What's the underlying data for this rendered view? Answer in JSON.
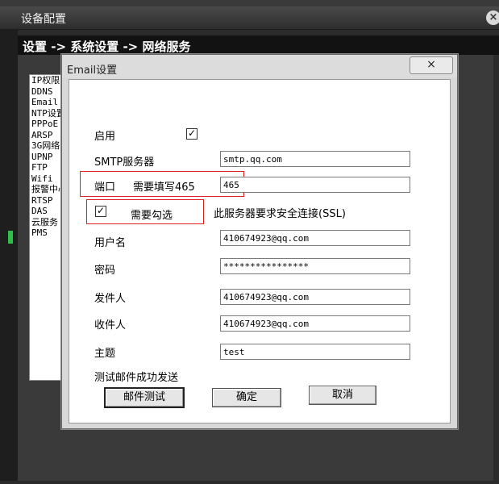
{
  "outer": {
    "title": "设备配置",
    "breadcrumb": "设置 -> 系统设置 -> 网络服务",
    "close_symbol": "×",
    "menu_items": [
      "IP权限",
      "DDNS",
      "Email",
      "NTP设置",
      "PPPoE",
      "ARSP",
      "3G网络",
      "UPNP",
      "FTP",
      "Wifi",
      "报警中心",
      "RTSP",
      "DAS",
      "云服务",
      "PMS"
    ]
  },
  "dialog": {
    "title": "Email设置",
    "close_symbol": "×",
    "enable_label": "启用",
    "enable_checked": true,
    "smtp_label": "SMTP服务器",
    "smtp_value": "smtp.qq.com",
    "port_label": "端口",
    "port_note": "需要填写465",
    "port_value": "465",
    "ssl_note": "需要勾选",
    "ssl_checked": true,
    "ssl_label": "此服务器要求安全连接(SSL)",
    "username_label": "用户名",
    "username_value": "410674923@qq.com",
    "password_label": "密码",
    "password_value": "****************",
    "sender_label": "发件人",
    "sender_value": "410674923@qq.com",
    "recipient_label": "收件人",
    "recipient_value": "410674923@qq.com",
    "subject_label": "主题",
    "subject_value": "test",
    "status_text": "测试邮件成功发送",
    "test_button": "邮件测试",
    "ok_button": "确定",
    "cancel_button": "取消",
    "check_symbol": "✓"
  },
  "colors": {
    "annotation_red": "#e02020",
    "status_green": "#2fbf4b"
  }
}
